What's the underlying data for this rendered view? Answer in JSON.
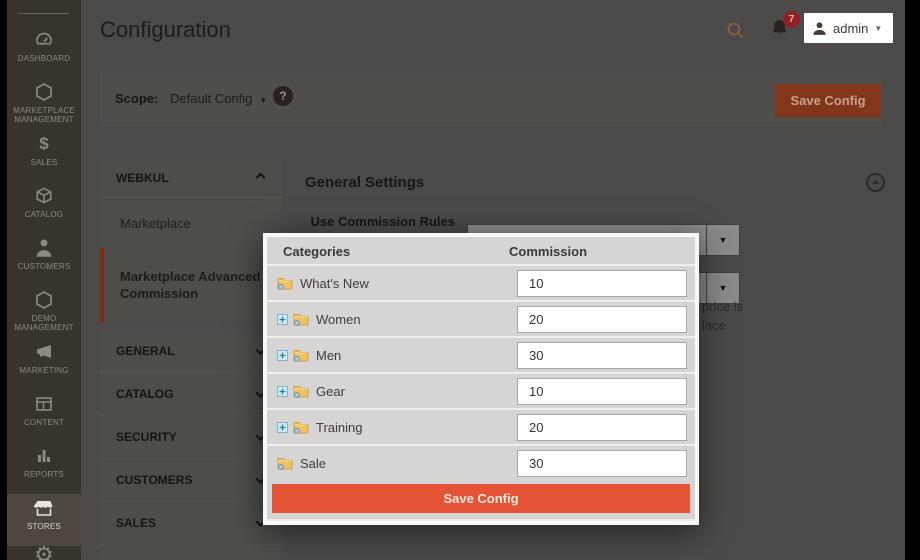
{
  "header": {
    "title": "Configuration",
    "notification_count": "7",
    "user": "admin"
  },
  "sidebar": {
    "items": [
      {
        "label": "DASHBOARD",
        "icon": "dashboard-icon",
        "active": false
      },
      {
        "label": "MARKETPLACE MANAGEMENT",
        "icon": "marketplace-icon",
        "active": false
      },
      {
        "label": "SALES",
        "icon": "sales-icon",
        "active": false
      },
      {
        "label": "CATALOG",
        "icon": "catalog-icon",
        "active": false
      },
      {
        "label": "CUSTOMERS",
        "icon": "customers-icon",
        "active": false
      },
      {
        "label": "DEMO MANAGEMENT",
        "icon": "demo-management-icon",
        "active": false
      },
      {
        "label": "MARKETING",
        "icon": "marketing-icon",
        "active": false
      },
      {
        "label": "CONTENT",
        "icon": "content-icon",
        "active": false
      },
      {
        "label": "REPORTS",
        "icon": "reports-icon",
        "active": false
      },
      {
        "label": "STORES",
        "icon": "stores-icon",
        "active": true
      }
    ]
  },
  "scope_bar": {
    "label": "Scope:",
    "value": "Default Config",
    "save_label": "Save Config"
  },
  "config_nav": {
    "webkul": {
      "label": "WEBKUL",
      "children": [
        {
          "label": "Marketplace",
          "active": false
        },
        {
          "label": "Marketplace Advanced Commission",
          "active": true
        }
      ]
    },
    "sections": [
      {
        "label": "GENERAL"
      },
      {
        "label": "CATALOG"
      },
      {
        "label": "SECURITY"
      },
      {
        "label": "CUSTOMERS"
      },
      {
        "label": "SALES"
      }
    ]
  },
  "settings": {
    "section_title": "General Settings",
    "field_label": "Use Commission Rules",
    "note_line1": "price is",
    "note_line2": "lace"
  },
  "modal": {
    "columns": [
      "Categories",
      "Commission"
    ],
    "rows": [
      {
        "name": "What's New",
        "value": "10",
        "expandable": false
      },
      {
        "name": "Women",
        "value": "20",
        "expandable": true
      },
      {
        "name": "Men",
        "value": "30",
        "expandable": true
      },
      {
        "name": "Gear",
        "value": "10",
        "expandable": true
      },
      {
        "name": "Training",
        "value": "20",
        "expandable": true
      },
      {
        "name": "Sale",
        "value": "30",
        "expandable": false
      }
    ],
    "save_label": "Save Config"
  },
  "colors": {
    "accent_orange": "#e65438",
    "dimmed_save_orange": "#82371a",
    "badge_red": "#8e2026",
    "sidebar_bg": "#39332d",
    "overlay_gray": "#4b4a48",
    "modal_bg": "#d6d5d4"
  }
}
